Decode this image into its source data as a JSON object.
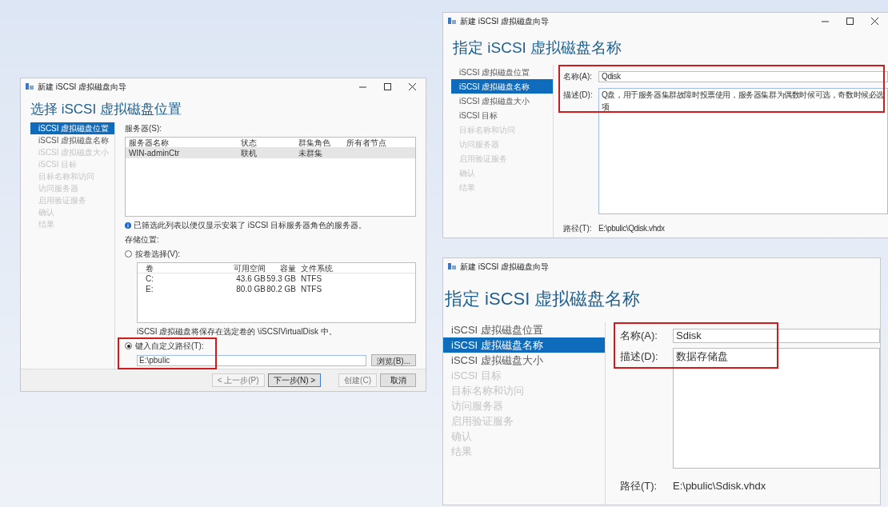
{
  "windows": [
    {
      "kind": "location",
      "title": "新建 iSCSI 虚拟磁盘向导",
      "window_buttons": true,
      "heading": "选择 iSCSI 虚拟磁盘位置",
      "steps": [
        {
          "label": "iSCSI 虚拟磁盘位置",
          "selected": true,
          "disabled": false
        },
        {
          "label": "iSCSI 虚拟磁盘名称",
          "selected": false,
          "disabled": false
        },
        {
          "label": "iSCSI 虚拟磁盘大小",
          "selected": false,
          "disabled": true
        },
        {
          "label": "iSCSI 目标",
          "selected": false,
          "disabled": true
        },
        {
          "label": "目标名称和访问",
          "selected": false,
          "disabled": true
        },
        {
          "label": "访问服务器",
          "selected": false,
          "disabled": true
        },
        {
          "label": "启用验证服务",
          "selected": false,
          "disabled": true
        },
        {
          "label": "确认",
          "selected": false,
          "disabled": true
        },
        {
          "label": "结果",
          "selected": false,
          "disabled": true
        }
      ],
      "servers_label": "服务器(S):",
      "servers": {
        "columns": [
          "服务器名称",
          "状态",
          "群集角色",
          "所有者节点"
        ],
        "rows": [
          {
            "cells": [
              "WIN-adminCtr",
              "联机",
              "未群集"
            ],
            "selected": true
          }
        ]
      },
      "info": "已筛选此列表以便仅显示安装了 iSCSI 目标服务器角色的服务器。",
      "storage_label": "存储位置:",
      "options": [
        {
          "label": "按卷选择(V):",
          "selected": false
        },
        {
          "label": "键入自定义路径(T):",
          "selected": true,
          "highlighted": true
        }
      ],
      "volumes": {
        "columns": [
          "卷",
          "可用空间",
          "容量",
          "文件系统"
        ],
        "rows": [
          {
            "cells": [
              "C:",
              "43.6 GB",
              "59.3 GB",
              "NTFS"
            ],
            "selected": false
          },
          {
            "cells": [
              "E:",
              "80.0 GB",
              "80.2 GB",
              "NTFS"
            ],
            "selected": false
          }
        ]
      },
      "volume_note": "iSCSI 虚拟磁盘将保存在选定卷的 \\iSCSIVirtualDisk 中。",
      "path_value": "E:\\pbulic",
      "browse": "浏览(B)...",
      "buttons": [
        {
          "label": "< 上一步(P)",
          "disabled": true,
          "default": false
        },
        {
          "label": "下一步(N) >",
          "disabled": false,
          "default": true
        },
        {
          "label": "创建(C)",
          "disabled": true,
          "default": false
        },
        {
          "label": "取消",
          "disabled": false,
          "default": false
        }
      ]
    },
    {
      "kind": "name",
      "title": "新建 iSCSI 虚拟磁盘向导",
      "window_buttons": true,
      "heading": "指定 iSCSI 虚拟磁盘名称",
      "steps": [
        {
          "label": "iSCSI 虚拟磁盘位置",
          "selected": false,
          "disabled": false
        },
        {
          "label": "iSCSI 虚拟磁盘名称",
          "selected": true,
          "disabled": false
        },
        {
          "label": "iSCSI 虚拟磁盘大小",
          "selected": false,
          "disabled": false
        },
        {
          "label": "iSCSI 目标",
          "selected": false,
          "disabled": false
        },
        {
          "label": "目标名称和访问",
          "selected": false,
          "disabled": true
        },
        {
          "label": "访问服务器",
          "selected": false,
          "disabled": true
        },
        {
          "label": "启用验证服务",
          "selected": false,
          "disabled": true
        },
        {
          "label": "确认",
          "selected": false,
          "disabled": true
        },
        {
          "label": "结果",
          "selected": false,
          "disabled": true
        }
      ],
      "name_label": "名称(A):",
      "name": "Qdisk",
      "description_label": "描述(D):",
      "description": "Q盘，用于服务器集群故障时投票使用，服务器集群为偶数时候可选，奇数时候必选项",
      "path_label": "路径(T):",
      "path": "E:\\pbulic\\Qdisk.vhdx",
      "highlighted": true
    },
    {
      "kind": "name",
      "title": "新建 iSCSI 虚拟磁盘向导",
      "window_buttons": false,
      "heading": "指定 iSCSI 虚拟磁盘名称",
      "steps": [
        {
          "label": "iSCSI 虚拟磁盘位置",
          "selected": false,
          "disabled": false
        },
        {
          "label": "iSCSI 虚拟磁盘名称",
          "selected": true,
          "disabled": false
        },
        {
          "label": "iSCSI 虚拟磁盘大小",
          "selected": false,
          "disabled": false
        },
        {
          "label": "iSCSI 目标",
          "selected": false,
          "disabled": true
        },
        {
          "label": "目标名称和访问",
          "selected": false,
          "disabled": true
        },
        {
          "label": "访问服务器",
          "selected": false,
          "disabled": true
        },
        {
          "label": "启用验证服务",
          "selected": false,
          "disabled": true
        },
        {
          "label": "确认",
          "selected": false,
          "disabled": true
        },
        {
          "label": "结果",
          "selected": false,
          "disabled": true
        }
      ],
      "name_label": "名称(A):",
      "name": "Sdisk",
      "description_label": "描述(D):",
      "description": "数据存储盘",
      "path_label": "路径(T):",
      "path": "E:\\pbulic\\Sdisk.vhdx",
      "highlighted": true
    }
  ]
}
